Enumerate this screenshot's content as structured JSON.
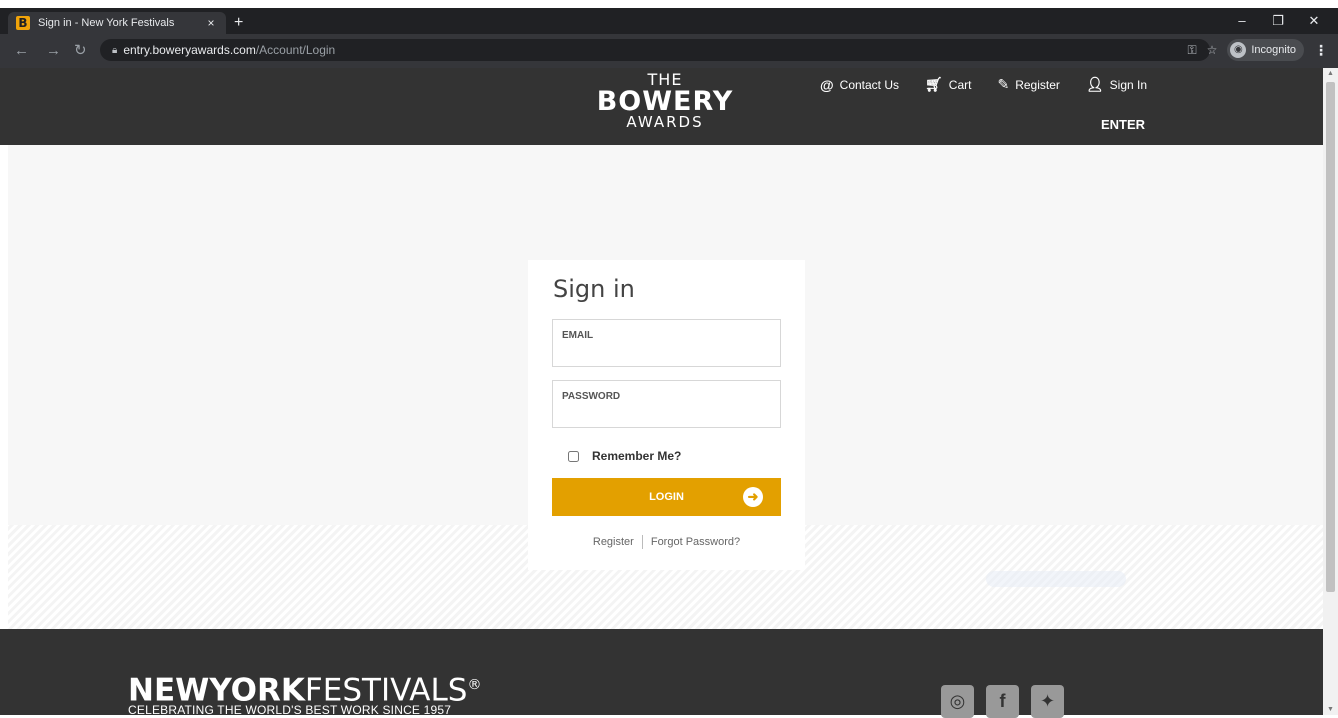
{
  "browser": {
    "tab_title": "Sign in - New York Festivals",
    "favicon_letter": "B",
    "tab_close": "×",
    "new_tab": "+",
    "url_host": "entry.boweryawards.com",
    "url_path": "/Account/Login",
    "incognito_label": "Incognito",
    "window_controls": [
      "–",
      "❐",
      "✕"
    ]
  },
  "header": {
    "logo": {
      "the": "THE",
      "main": "BOWERY",
      "awards": "AWARDS"
    },
    "nav": [
      {
        "label": "Contact Us",
        "icon": "at-icon"
      },
      {
        "label": "Cart",
        "icon": "cart-icon"
      },
      {
        "label": "Register",
        "icon": "edit-icon"
      },
      {
        "label": "Sign In",
        "icon": "user-icon"
      }
    ],
    "enter_label": "ENTER"
  },
  "signin": {
    "title": "Sign in",
    "email_label": "EMAIL",
    "email_value": "",
    "password_label": "PASSWORD",
    "password_value": "",
    "remember_label": "Remember Me?",
    "login_label": "LOGIN",
    "register_link": "Register",
    "forgot_link": "Forgot Password?"
  },
  "footer": {
    "brand_bold": "NEWYORK",
    "brand_light": "FESTIVALS",
    "brand_mark": "®",
    "tagline": "CELEBRATING THE WORLD'S BEST WORK SINCE 1957",
    "socials": [
      "instagram-icon",
      "facebook-icon",
      "twitter-icon"
    ]
  },
  "colors": {
    "header_bg": "#333333",
    "accent": "#e3a000",
    "browser_dark": "#202124"
  }
}
